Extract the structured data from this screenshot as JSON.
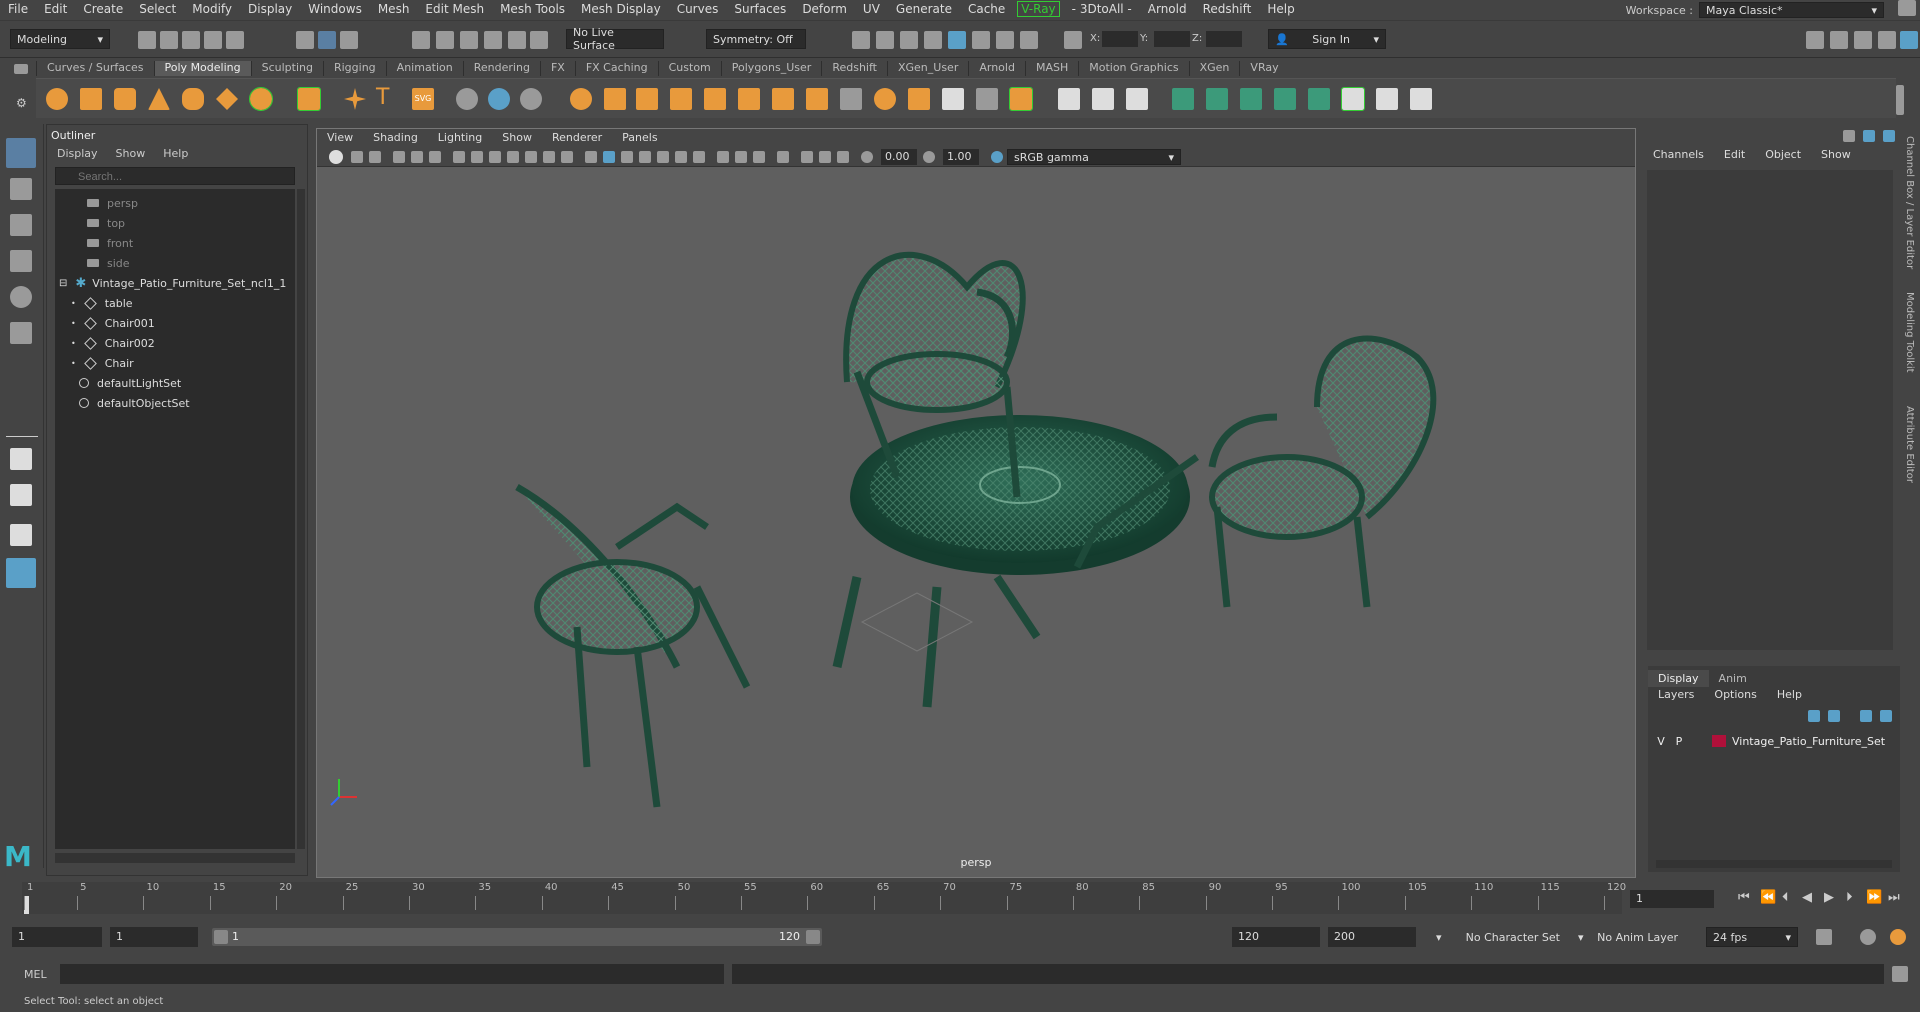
{
  "menubar": {
    "items": [
      "File",
      "Edit",
      "Create",
      "Select",
      "Modify",
      "Display",
      "Windows",
      "Mesh",
      "Edit Mesh",
      "Mesh Tools",
      "Mesh Display",
      "Curves",
      "Surfaces",
      "Deform",
      "UV",
      "Generate",
      "Cache",
      "V-Ray",
      "- 3DtoAll -",
      "Arnold",
      "Redshift",
      "Help"
    ],
    "workspace_label": "Workspace :",
    "workspace_value": "Maya Classic*"
  },
  "statusline": {
    "mode": "Modeling",
    "live_surface": "No Live Surface",
    "symmetry": "Symmetry: Off",
    "x_label": "X:",
    "y_label": "Y:",
    "z_label": "Z:",
    "sign_in": "Sign In"
  },
  "shelf": {
    "tabs": [
      "Curves / Surfaces",
      "Poly Modeling",
      "Sculpting",
      "Rigging",
      "Animation",
      "Rendering",
      "FX",
      "FX Caching",
      "Custom",
      "Polygons_User",
      "Redshift",
      "XGen_User",
      "Arnold",
      "MASH",
      "Motion Graphics",
      "XGen",
      "VRay"
    ],
    "active_tab": "Poly Modeling"
  },
  "outliner": {
    "title": "Outliner",
    "menu": [
      "Display",
      "Show",
      "Help"
    ],
    "search_placeholder": "Search...",
    "cameras": [
      "persp",
      "top",
      "front",
      "side"
    ],
    "group": "Vintage_Patio_Furniture_Set_ncl1_1",
    "children": [
      "table",
      "Chair001",
      "Chair002",
      "Chair"
    ],
    "sets": [
      "defaultLightSet",
      "defaultObjectSet"
    ]
  },
  "viewport": {
    "menu": [
      "View",
      "Shading",
      "Lighting",
      "Show",
      "Renderer",
      "Panels"
    ],
    "exposure": "0.00",
    "gamma": "1.00",
    "color_space": "sRGB gamma",
    "camera_label": "persp"
  },
  "channelbox": {
    "menu": [
      "Channels",
      "Edit",
      "Object",
      "Show"
    ]
  },
  "layer_editor": {
    "tabs": [
      "Display",
      "Anim"
    ],
    "active_tab": "Display",
    "menu": [
      "Layers",
      "Options",
      "Help"
    ],
    "layer": {
      "v": "V",
      "p": "P",
      "name": "Vintage_Patio_Furniture_Set",
      "color": "#b0103a"
    }
  },
  "side_tabs": [
    "Channel Box / Layer Editor",
    "Modeling Toolkit",
    "Attribute Editor"
  ],
  "timeline": {
    "ticks": [
      "1",
      "5",
      "10",
      "15",
      "20",
      "25",
      "30",
      "35",
      "40",
      "45",
      "50",
      "55",
      "60",
      "65",
      "70",
      "75",
      "80",
      "85",
      "90",
      "95",
      "100",
      "105",
      "110",
      "115",
      "120"
    ],
    "current_frame": "1"
  },
  "range": {
    "start": "1",
    "start_inner": "1",
    "bar_start": "1",
    "bar_end": "120",
    "end_inner": "120",
    "end": "200",
    "character_set": "No Character Set",
    "anim_layer": "No Anim Layer",
    "fps": "24 fps"
  },
  "cmdline": {
    "label": "MEL"
  },
  "helpline": {
    "text": "Select Tool: select an object"
  },
  "colors": {
    "furniture": "#1e4a3a",
    "layer_color": "#b0103a"
  }
}
